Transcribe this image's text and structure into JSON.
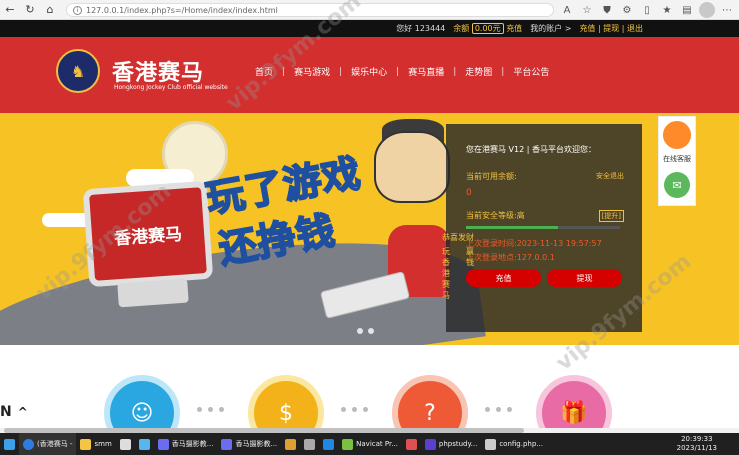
{
  "browser": {
    "url": "127.0.0.1/index.php?s=/Home/index/index.html"
  },
  "topbar": {
    "greeting": "您好 123444",
    "balance_label": "余额",
    "balance_value": "0.00元",
    "balance_action": "充值",
    "account_link": "我的账户 >",
    "recharge": "充值",
    "withdraw": "提现",
    "logout": "退出"
  },
  "header": {
    "logo_title": "香港赛马",
    "logo_sub": "Hongkong Jockey Club official website",
    "nav": [
      "首页",
      "赛马游戏",
      "娱乐中心",
      "赛马直播",
      "走势图",
      "平台公告"
    ]
  },
  "banner": {
    "monitor_text": "香港赛马",
    "slogan_line1": "玩了游戏",
    "slogan_line2": "还挣钱"
  },
  "panel": {
    "welcome": "您在港赛马 V12 | 香马平台欢迎您：",
    "available_label": "当前可用余额:",
    "available_link": "安全退出",
    "available_value": "0",
    "security_label": "当前安全等级:高",
    "security_upgrade": "[提升]",
    "security_level": 0.6,
    "last_login_time": "上次登录时间:2023-11-13 19:57:57",
    "last_login_ip": "上次登录地点:127.0.0.1",
    "btn_recharge": "充值",
    "btn_withdraw": "提现"
  },
  "vertical": {
    "title": "恭喜发财",
    "col1": [
      "玩",
      "香",
      "港",
      "赛",
      "马"
    ],
    "col2": [
      "赢",
      "",
      "",
      "",
      "钱"
    ]
  },
  "cs": {
    "label": "在线客服"
  },
  "taskbar": {
    "items": [
      "(香港赛马 -",
      "smm",
      "",
      "香马摄影教...",
      "",
      "香马摄影教...",
      "",
      "",
      "Navicat Pr...",
      "",
      "phpstudy...",
      "config.php..."
    ],
    "time": "20:39:33",
    "date": "2023/11/13"
  },
  "side_mark": {
    "text": "N"
  },
  "colors": {
    "header_red": "#d32f2f",
    "banner_yellow": "#f7c324",
    "accent_gold": "#f0c040",
    "button_red": "#d50000"
  }
}
